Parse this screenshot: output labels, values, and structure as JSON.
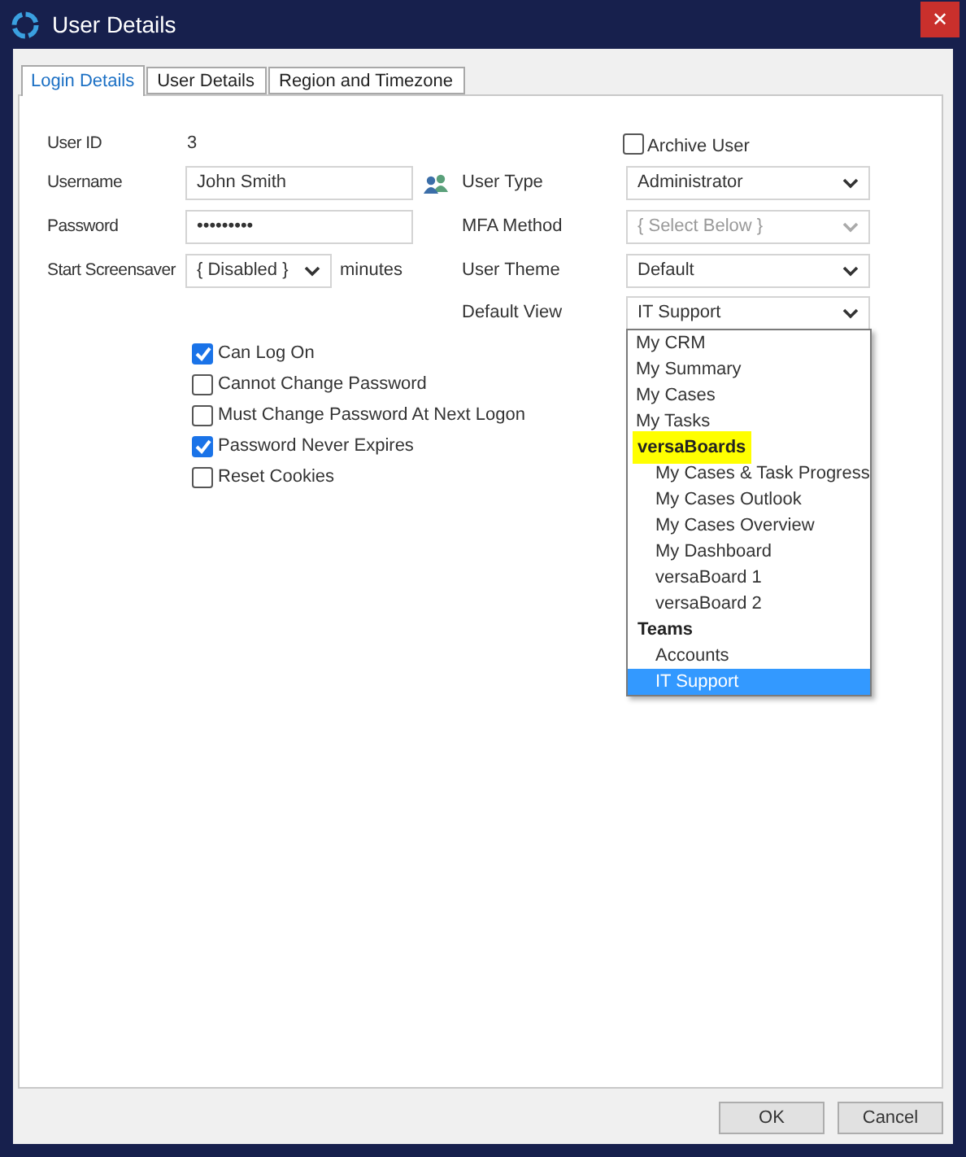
{
  "window": {
    "title": "User Details",
    "close": "✕"
  },
  "tabs": [
    {
      "label": "Login Details",
      "selected": true
    },
    {
      "label": "User Details",
      "selected": false
    },
    {
      "label": "Region and Timezone",
      "selected": false
    }
  ],
  "left_fields": [
    {
      "kind": "text",
      "label": "User ID",
      "value": "3"
    },
    {
      "kind": "input",
      "label": "Username",
      "value": "John Smith",
      "icon": true
    },
    {
      "kind": "input",
      "label": "Password",
      "value": "•••••••••"
    },
    {
      "kind": "select",
      "label": "Start Screensaver",
      "value": "{ Disabled }",
      "suffix": "minutes",
      "disabled": false
    }
  ],
  "archive_user": {
    "label": "Archive User",
    "checked": false
  },
  "right_fields": [
    {
      "label": "User Type",
      "value": "Administrator",
      "disabled": false
    },
    {
      "label": "MFA Method",
      "value": "{ Select Below }",
      "disabled": true
    },
    {
      "label": "User Theme",
      "value": "Default",
      "disabled": false
    },
    {
      "label": "Default View",
      "value": "IT Support",
      "disabled": false
    }
  ],
  "checkboxes": [
    {
      "label": "Can Log On",
      "checked": true
    },
    {
      "label": "Cannot Change Password",
      "checked": false
    },
    {
      "label": "Must Change Password At Next Logon",
      "checked": false
    },
    {
      "label": "Password Never Expires",
      "checked": true
    },
    {
      "label": "Reset Cookies",
      "checked": false
    }
  ],
  "dropdown": [
    {
      "label": "My CRM",
      "selected": false
    },
    {
      "label": "My Summary",
      "selected": false
    },
    {
      "label": "My Cases",
      "selected": false
    },
    {
      "label": "My Tasks",
      "selected": false
    },
    {
      "label": "versaBoards",
      "highlighted": true,
      "children": [
        {
          "label": "My Cases & Task Progress",
          "selected": false
        },
        {
          "label": "My Cases Outlook",
          "selected": false
        },
        {
          "label": "My Cases Overview",
          "selected": false
        },
        {
          "label": "My Dashboard",
          "selected": false
        },
        {
          "label": "versaBoard 1",
          "selected": false
        },
        {
          "label": "versaBoard 2",
          "selected": false
        }
      ]
    },
    {
      "label": "Teams",
      "highlighted": false,
      "children": [
        {
          "label": "Accounts",
          "selected": false
        },
        {
          "label": "IT Support",
          "selected": true
        }
      ]
    }
  ],
  "buttons": [
    "OK",
    "Cancel"
  ]
}
